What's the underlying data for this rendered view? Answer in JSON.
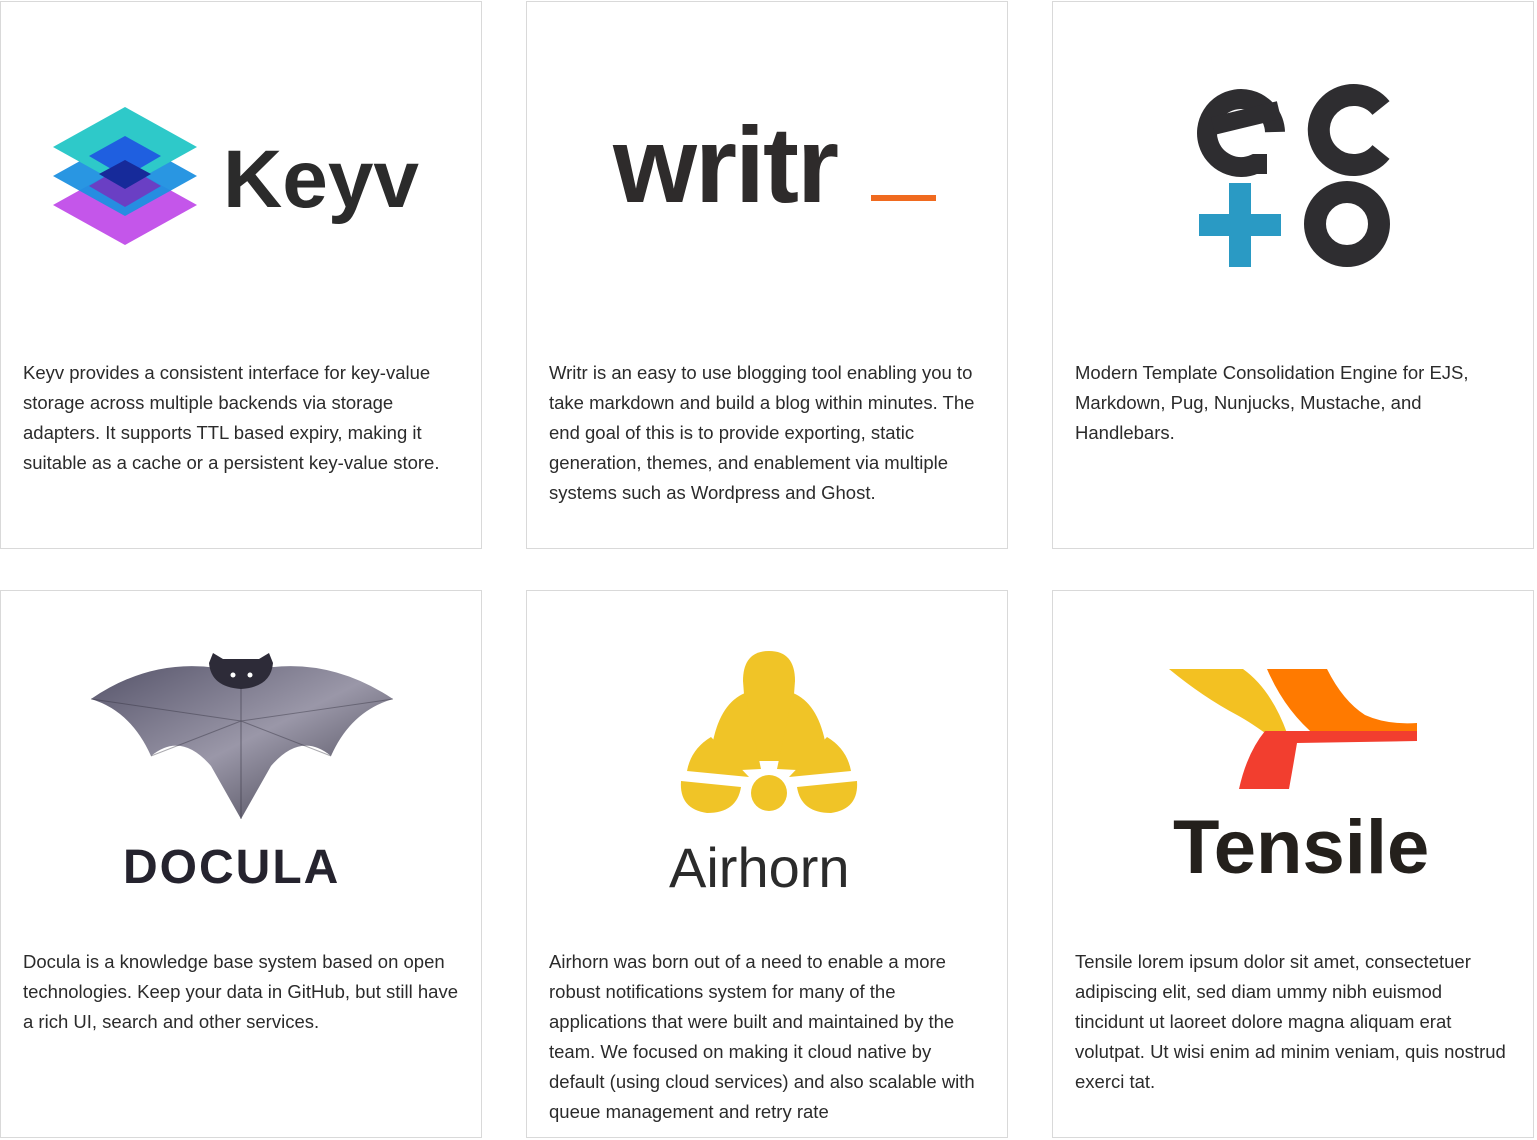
{
  "projects": [
    {
      "name": "Keyv",
      "logo_text": "Keyv",
      "description": "Keyv provides a consistent interface for key-value storage across multiple backends via storage adapters. It supports TTL based expiry, making it suitable as a cache or a persistent key-value store."
    },
    {
      "name": "Writr",
      "logo_text": "writr",
      "description": "Writr is an easy to use blogging tool enabling you to take markdown and build a blog within minutes. The end goal of this is to provide exporting, static generation, themes, and enablement via multiple systems such as Wordpress and Ghost."
    },
    {
      "name": "Ecto",
      "logo_text": "ecto",
      "description": "Modern Template Consolidation Engine for EJS, Markdown, Pug, Nunjucks, Mustache, and Handlebars."
    },
    {
      "name": "Docula",
      "logo_text": "DOCULA",
      "description": "Docula is a knowledge base system based on open technologies. Keep your data in GitHub, but still have a rich UI, search and other services."
    },
    {
      "name": "Airhorn",
      "logo_text": "Airhorn",
      "description": "Airhorn was born out of a need to enable a more robust notifications system for many of the applications that were built and maintained by the team. We focused on making it cloud native by default (using cloud services) and also scalable with queue management and retry rate"
    },
    {
      "name": "Tensile",
      "logo_text": "Tensile",
      "description": "Tensile lorem ipsum dolor sit amet, consectetuer adipiscing elit, sed diam ummy nibh euismod tincidunt ut laoreet dolore magna aliquam erat volutpat. Ut wisi enim ad minim veniam, quis nostrud exerci tat."
    }
  ],
  "colors": {
    "keyv_teal": "#2ec9c9",
    "keyv_blue": "#1f6fe0",
    "keyv_purple": "#c456ea",
    "writr_underscore": "#f06a1f",
    "ecto_plus": "#2a9ac4",
    "airhorn_yellow": "#f0c427",
    "tensile_yellow": "#f3c122",
    "tensile_orange": "#ff7a00",
    "tensile_red": "#f23e2f",
    "text_dark": "#2b2b2b"
  }
}
